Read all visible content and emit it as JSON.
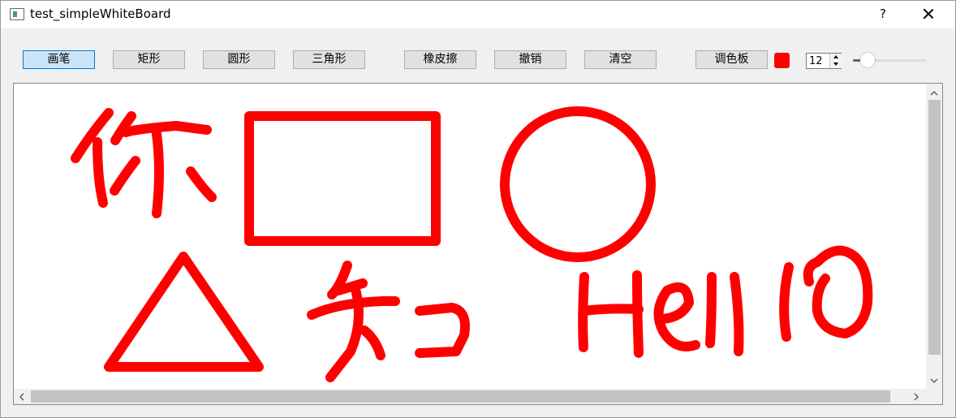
{
  "window": {
    "title": "test_simpleWhiteBoard",
    "help_label": "?"
  },
  "toolbar": {
    "pen": "画笔",
    "rectangle": "矩形",
    "circle": "圆形",
    "triangle": "三角形",
    "eraser": "橡皮擦",
    "undo": "撤销",
    "clear": "清空",
    "palette": "调色板",
    "active_tool": "pen",
    "current_color": "#ff0000",
    "pen_size": "12",
    "pen_size_slider": {
      "value": 12,
      "min": 0,
      "max": 100
    }
  },
  "canvas": {
    "stroke_color": "#ff0000",
    "vscroll_fraction": 0.0,
    "hscroll_fraction": 0.0
  }
}
